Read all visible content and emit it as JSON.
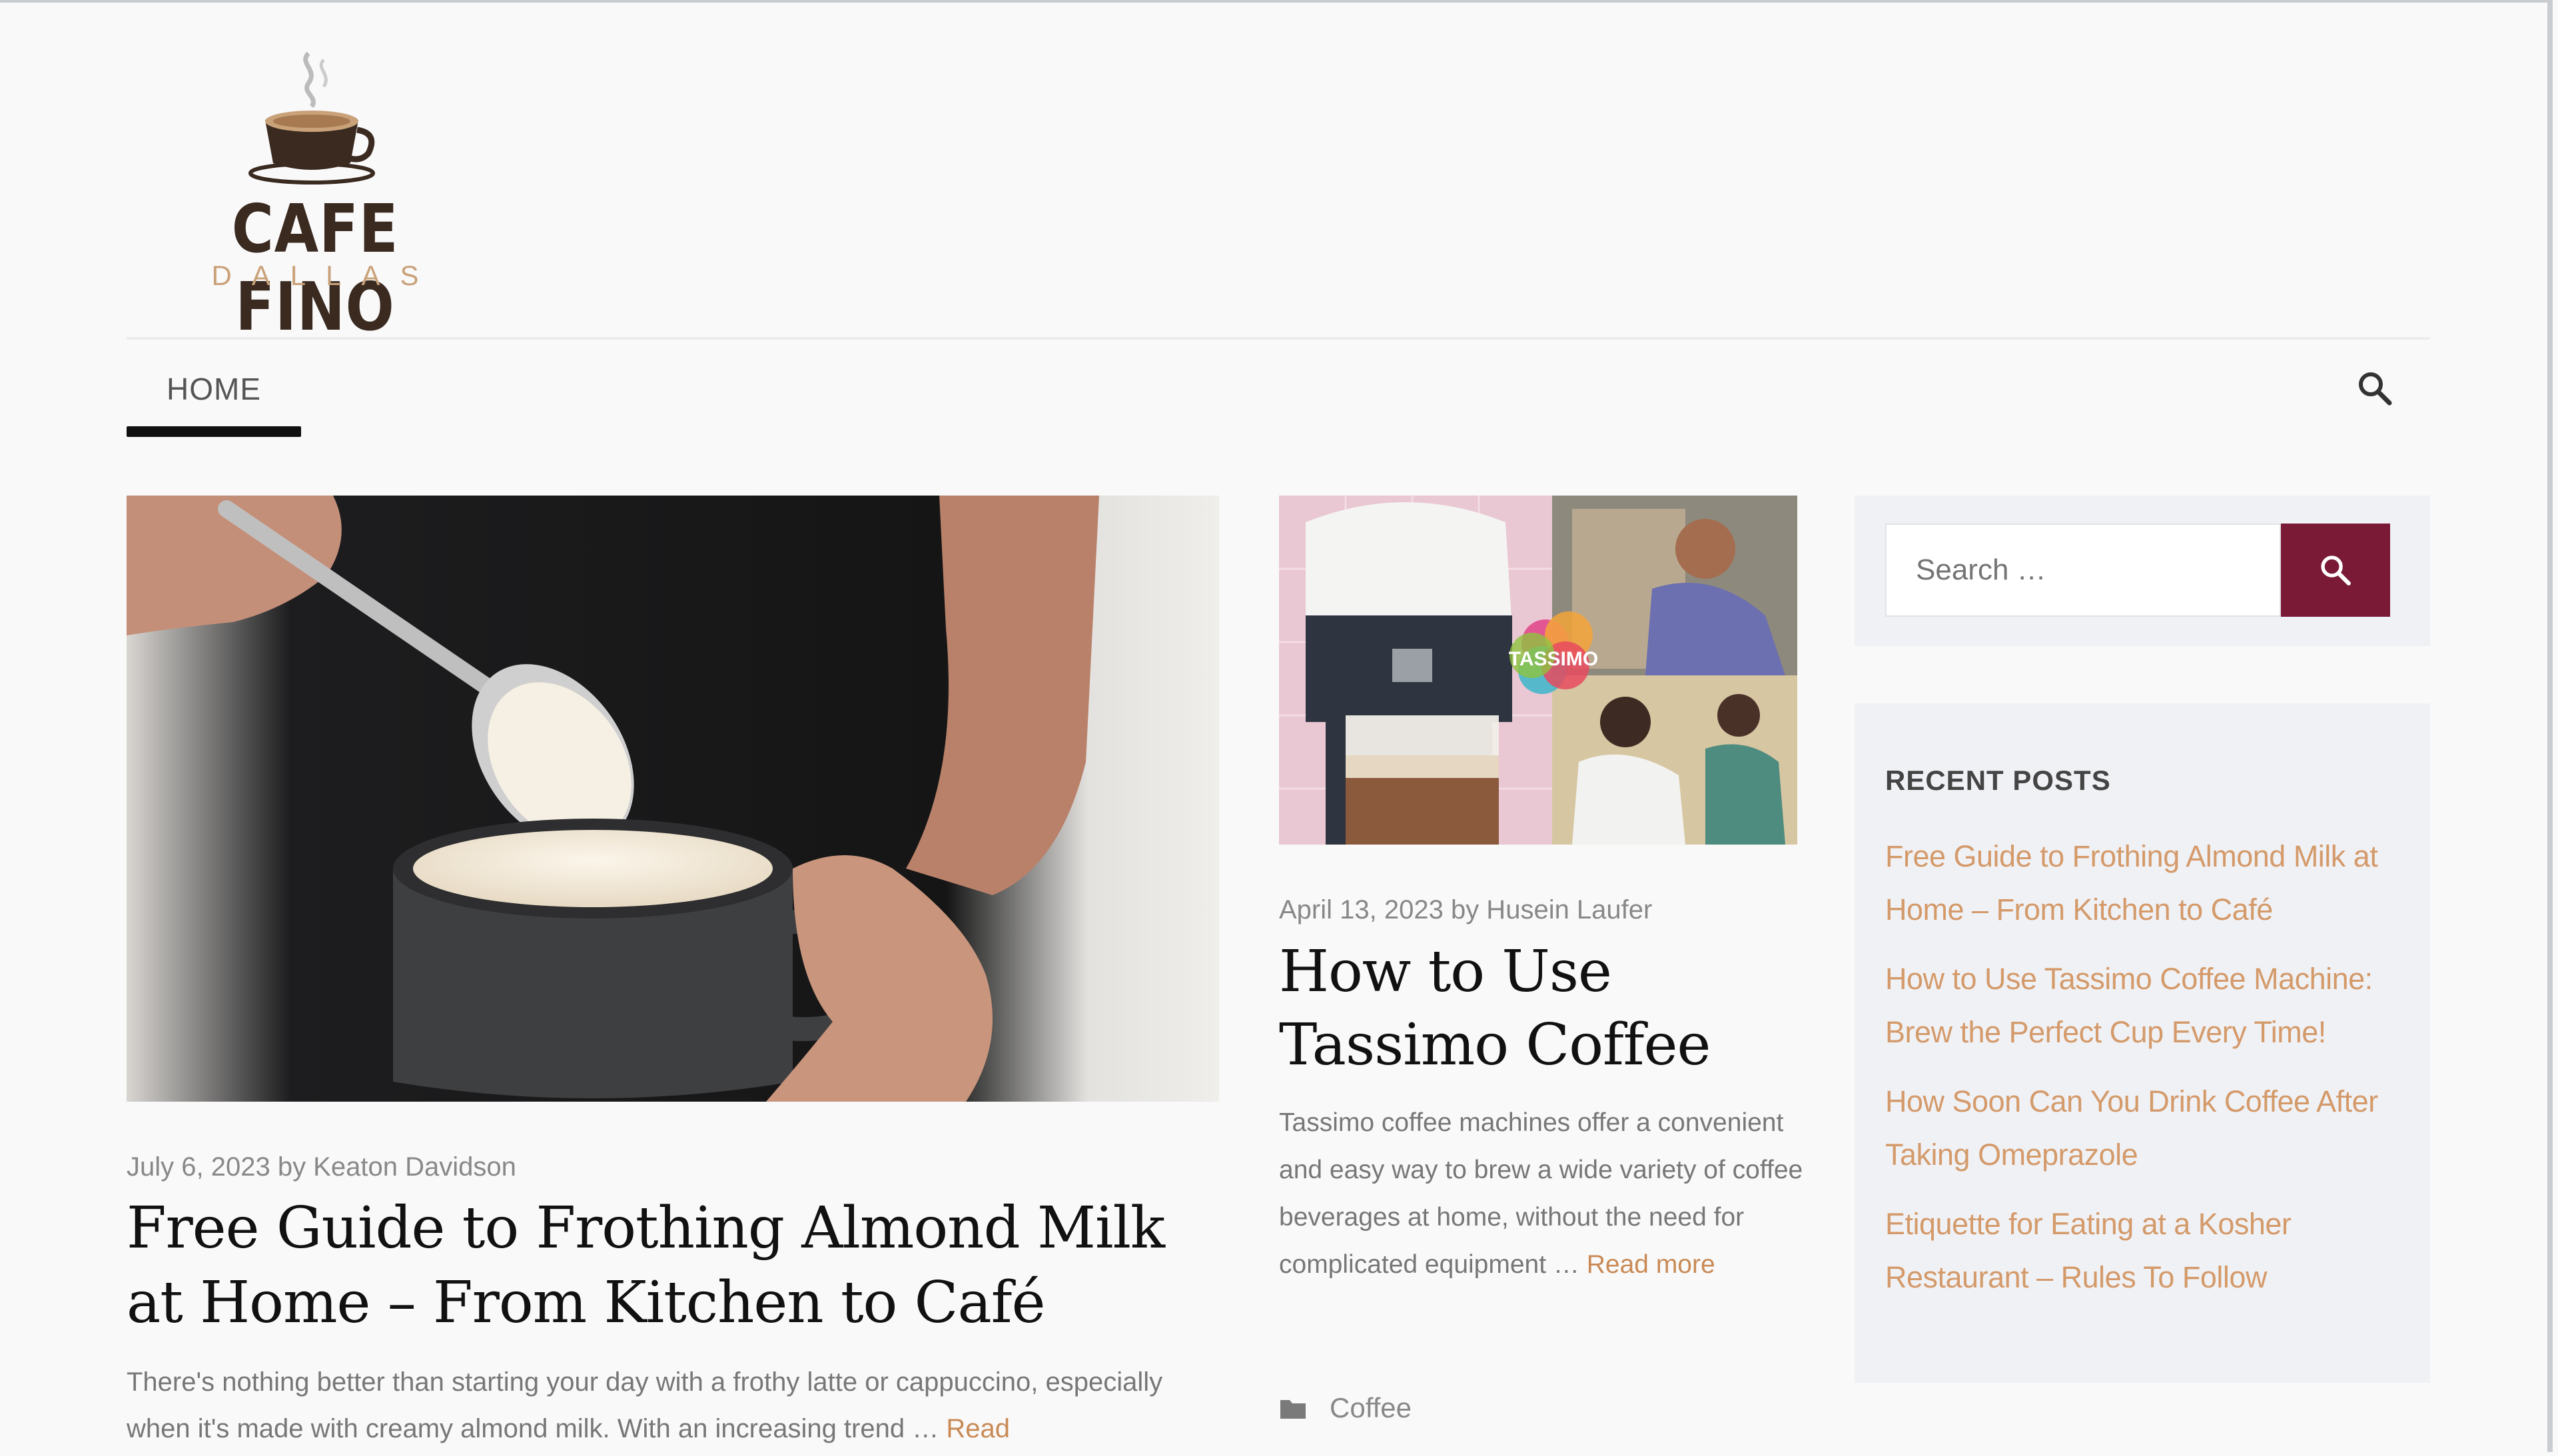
{
  "site": {
    "logo_name": "CAFE FINO",
    "logo_sub": "DALLAS"
  },
  "nav": {
    "home_label": "HOME",
    "search_icon": "search-icon"
  },
  "featured_post": {
    "meta": "July 6, 2023 by Keaton Davidson",
    "title": "Free Guide to Frothing Almond Milk at Home – From Kitchen to Café",
    "excerpt": "There's nothing better than starting your day with a frothy latte or cappuccino, especially when it's made with creamy almond milk. With an increasing trend …",
    "read_more": "Read"
  },
  "second_post": {
    "meta": "April 13, 2023 by Husein Laufer",
    "title": "How to Use Tassimo Coffee",
    "image_logo_text": "TASSIMO",
    "excerpt": "Tassimo coffee machines offer a convenient and easy way to brew a wide variety of coffee beverages at home, without the need for complicated equipment …",
    "read_more": "Read more",
    "category": "Coffee",
    "category_icon": "folder-icon"
  },
  "sidebar": {
    "search_placeholder": "Search …",
    "search_button_icon": "search-icon",
    "recent_heading": "RECENT POSTS",
    "recent_posts": [
      "Free Guide to Frothing Almond Milk at Home – From Kitchen to Café",
      "How to Use Tassimo Coffee Machine: Brew the Perfect Cup Every Time!",
      "How Soon Can You Drink Coffee After Taking Omeprazole",
      "Etiquette for Eating at a Kosher Restaurant – Rules To Follow"
    ]
  },
  "colors": {
    "accent": "#7a1a36",
    "link": "#d49a6a",
    "logo_dark": "#3a2a20",
    "logo_gold": "#c9a27a"
  }
}
